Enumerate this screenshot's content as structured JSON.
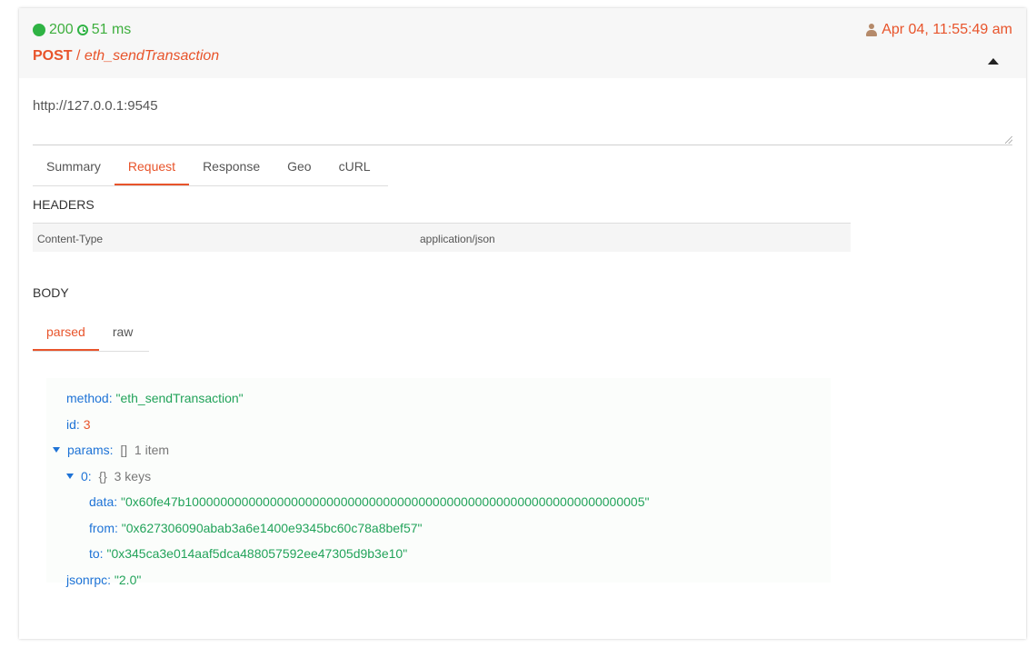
{
  "request": {
    "status_code": "200",
    "duration": "51 ms",
    "method": "POST",
    "path_separator": "/",
    "endpoint": "eth_sendTransaction",
    "timestamp": "Apr 04, 11:55:49 am",
    "url": "http://127.0.0.1:9545"
  },
  "tabs": [
    {
      "label": "Summary",
      "active": false
    },
    {
      "label": "Request",
      "active": true
    },
    {
      "label": "Response",
      "active": false
    },
    {
      "label": "Geo",
      "active": false
    },
    {
      "label": "cURL",
      "active": false
    }
  ],
  "headers_section": {
    "title": "HEADERS",
    "rows": [
      {
        "key": "Content-Type",
        "value": "application/json"
      }
    ]
  },
  "body_section": {
    "title": "BODY",
    "tabs": [
      {
        "label": "parsed",
        "active": true
      },
      {
        "label": "raw",
        "active": false
      }
    ]
  },
  "json_tree": {
    "method_key": "method:",
    "method_val": "\"eth_sendTransaction\"",
    "id_key": "id:",
    "id_val": "3",
    "params_key": "params:",
    "params_bracket": "[]",
    "params_count": "1 item",
    "item0_key": "0:",
    "item0_bracket": "{}",
    "item0_count": "3 keys",
    "data_key": "data:",
    "data_val": "\"0x60fe47b10000000000000000000000000000000000000000000000000000000000000005\"",
    "from_key": "from:",
    "from_val": "\"0x627306090abab3a6e1400e9345bc60c78a8bef57\"",
    "to_key": "to:",
    "to_val": "\"0x345ca3e014aaf5dca488057592ee47305d9b3e10\"",
    "jsonrpc_key": "jsonrpc:",
    "jsonrpc_val": "\"2.0\""
  },
  "colors": {
    "accent": "#e8542b",
    "success": "#2fb344",
    "json_key": "#1e73d6",
    "json_string": "#22a35a"
  }
}
